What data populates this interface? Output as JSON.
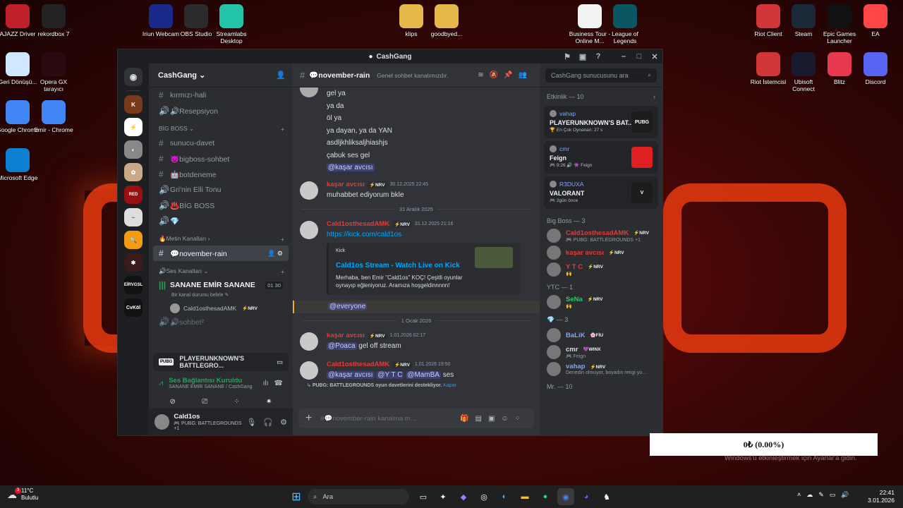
{
  "desktop_icons": [
    {
      "label": "AJAZZ Driver",
      "icon": "ajazz-icon",
      "color": "#c0202a"
    },
    {
      "label": "rekordbox 7",
      "icon": "rekordbox-icon",
      "color": "#222"
    },
    {
      "label": "Iriun Webcam",
      "icon": "iriun-icon",
      "color": "#1a2a8a"
    },
    {
      "label": "OBS Studio",
      "icon": "obs-icon",
      "color": "#2b2b2b"
    },
    {
      "label": "Streamlabs Desktop",
      "icon": "streamlabs-icon",
      "color": "#22c3a6"
    },
    {
      "label": "klips",
      "icon": "folder-icon",
      "color": "#e6b84a"
    },
    {
      "label": "goodbyed...",
      "icon": "folder-icon",
      "color": "#e6b84a"
    },
    {
      "label": "Business Tour - Online M...",
      "icon": "file-icon",
      "color": "#f2f2f2"
    },
    {
      "label": "League of Legends",
      "icon": "lol-icon",
      "color": "#0b5663"
    },
    {
      "label": "Riot Client",
      "icon": "riot-icon",
      "color": "#d13639"
    },
    {
      "label": "Steam",
      "icon": "steam-icon",
      "color": "#1b2838"
    },
    {
      "label": "Epic Games Launcher",
      "icon": "epic-icon",
      "color": "#111"
    },
    {
      "label": "EA",
      "icon": "ea-icon",
      "color": "#ff4747"
    },
    {
      "label": "Geri Dönüşü...",
      "icon": "recycle-bin-icon",
      "color": "#cfe8ff"
    },
    {
      "label": "Opera GX tarayıcı",
      "icon": "opera-gx-icon",
      "color": "#2a0a10"
    },
    {
      "label": "Riot İstemcisi",
      "icon": "riot-icon",
      "color": "#d13639"
    },
    {
      "label": "Ubisoft Connect",
      "icon": "ubisoft-icon",
      "color": "#1a1a2e"
    },
    {
      "label": "Blitz",
      "icon": "blitz-icon",
      "color": "#e8384f"
    },
    {
      "label": "Discord",
      "icon": "discord-icon",
      "color": "#5865f2"
    },
    {
      "label": "Google Chrome",
      "icon": "chrome-icon",
      "color": "#4285f4"
    },
    {
      "label": "Emir - Chrome",
      "icon": "chrome-icon",
      "color": "#4285f4"
    },
    {
      "label": "Microsoft Edge",
      "icon": "edge-icon",
      "color": "#0c7fd1"
    }
  ],
  "window": {
    "title": "CashGang"
  },
  "server": {
    "name": "CashGang",
    "channels_top": [
      {
        "name": "kırmızı-hali",
        "icon": "hash"
      },
      {
        "name": "🔊Resepsiyon",
        "icon": "speaker"
      }
    ],
    "category_bigboss": "BİG BOSS",
    "channels_bigboss": [
      {
        "name": "sunucu-davet",
        "icon": "hash"
      },
      {
        "name": "👿bigboss-sohbet",
        "icon": "hash"
      },
      {
        "name": "🤖botdeneme",
        "icon": "hash"
      },
      {
        "name": "Gri'nin Elli Tonu",
        "icon": "speaker"
      },
      {
        "name": "♨️BİG BOSS",
        "icon": "speaker"
      },
      {
        "name": "💎",
        "icon": "speaker"
      }
    ],
    "category_metin": "🔥Metin Kanalları",
    "active_channel": "💬november-rain",
    "category_ses": "🔊Ses Kanalları",
    "voice_channel": {
      "name": "SANANE EMİR SANANE",
      "count_a": "01",
      "count_b": "30",
      "status": "Bir kanal durumu belirle"
    },
    "voice_user": "Cald1osthesadAMK",
    "next_channel": "🔊sohbet²"
  },
  "voice_panel": {
    "game": "PLAYERUNKNOWN'S BATTLEGRO...",
    "status": "Ses Bağlantısı Kuruldu",
    "sub": "SANANE EMİR SANANE / CashGang"
  },
  "user": {
    "name": "Cald1os",
    "status": "🎮 PUBG: BATTLEGROUNDS +1"
  },
  "chat": {
    "channel": "💬november-rain",
    "topic": "Genel sohbet kanalımızdır.",
    "lines": [
      "gel ya",
      "ya da",
      "öl ya",
      "ya dayan, ya da YAN",
      "asdljkhliksaljhiashjs",
      "çabuk ses gel"
    ],
    "mention1": "@kaşar avcısı",
    "msg2": {
      "name": "kaşar avcısı",
      "tag": "⚡NRV",
      "time": "30.12.2025 22:45",
      "body": "muhabbet ediyorum bkle"
    },
    "date1": "31 Aralık 2025",
    "msg3": {
      "name": "Cald1osthesadAMK",
      "tag": "⚡NRV",
      "time": "31.12.2025 21:16",
      "link": "https://kick.com/cald1os"
    },
    "embed": {
      "provider": "Kick",
      "title": "Cald1os Stream - Watch Live on Kick",
      "desc": "Merhaba, ben Emir \"Cald1os\" KOÇ! Çeşitli oyunlar oynayıp eğleniyoruz. Aramıza hoşgeldinnnnn!"
    },
    "everyone": "@everyone",
    "date2": "1 Ocak 2026",
    "msg4": {
      "name": "kaşar avcısı",
      "tag": "⚡NRV",
      "time": "1.01.2026 02:17",
      "mention": "@Poaca",
      "body": "gel off stream"
    },
    "msg5": {
      "name": "Cald1osthesadAMK",
      "tag": "⚡NRV",
      "time": "1.01.2026 19:50",
      "m1": "@kaşar avcısı",
      "m2": "@Y T C",
      "m3": "@MamBA",
      "body": "ses"
    },
    "invite_note": "PUBG: BATTLEGROUNDS oyun davetlerini destekliyor.",
    "invite_close": "Kapat",
    "composer_placeholder": "#💬november-rain kanalına m..."
  },
  "members": {
    "search_placeholder": "CashGang sunucusunu ara",
    "activity_header": "Etkinlik — 10",
    "activities": [
      {
        "user": "vahap",
        "title": "PLAYERUNKNOWN'S BAT...",
        "sub": "🏆 En Çok Oynanan: 27 s",
        "badge": "PUBG",
        "badge_color": "#1c1c1c"
      },
      {
        "user": "cmr",
        "title": "Feign",
        "sub": "🎮 9:26  🔊 👾 Feign",
        "badge": "",
        "badge_color": "#e02020"
      },
      {
        "user": "R3DUXA",
        "title": "VALORANT",
        "sub": "🎮 2gün önce",
        "badge": "V",
        "badge_color": "#1c1c1c"
      }
    ],
    "group_bigboss": "Big Boss — 3",
    "bigboss": [
      {
        "name": "Cald1osthesadAMK",
        "tag": "⚡NRV",
        "sub": "🎮 PUBG: BATTLEGROUNDS +1",
        "color": "#e23b3b"
      },
      {
        "name": "kaşar avcısı",
        "tag": "⚡NRV",
        "sub": "",
        "color": "#e23b3b"
      },
      {
        "name": "Y T C",
        "tag": "⚡NRV",
        "sub": "🙌",
        "color": "#e23b3b"
      }
    ],
    "group_ytc": "YTC — 1",
    "ytc": [
      {
        "name": "SeNa",
        "tag": "⚡NRV",
        "sub": "🙌",
        "color": "#2dc770"
      }
    ],
    "group_gem": "💎 — 3",
    "gem": [
      {
        "name": "BaLiK",
        "tag": "🌸FİU",
        "sub": "",
        "color": "#7aa7ff"
      },
      {
        "name": "cmr",
        "tag": "💜WINX",
        "sub": "🎮 Feign",
        "color": "#dbdee1"
      },
      {
        "name": "vahap",
        "tag": "⚡NRV",
        "sub": "Denedin olmuyor, boyadın rengi yo...",
        "color": "#7aa7ff"
      }
    ],
    "group_mr": "Mr. — 10"
  },
  "toast": {
    "text": "0₺ (0.00%)",
    "watermark": "Windows'u etkinleştirmek için Ayarlar'a gidin."
  },
  "taskbar": {
    "weather_temp": "11°C",
    "weather_desc": "Bulutlu",
    "weather_badge": "3",
    "search_placeholder": "Ara",
    "time": "22:41",
    "date": "3.01.2026"
  }
}
